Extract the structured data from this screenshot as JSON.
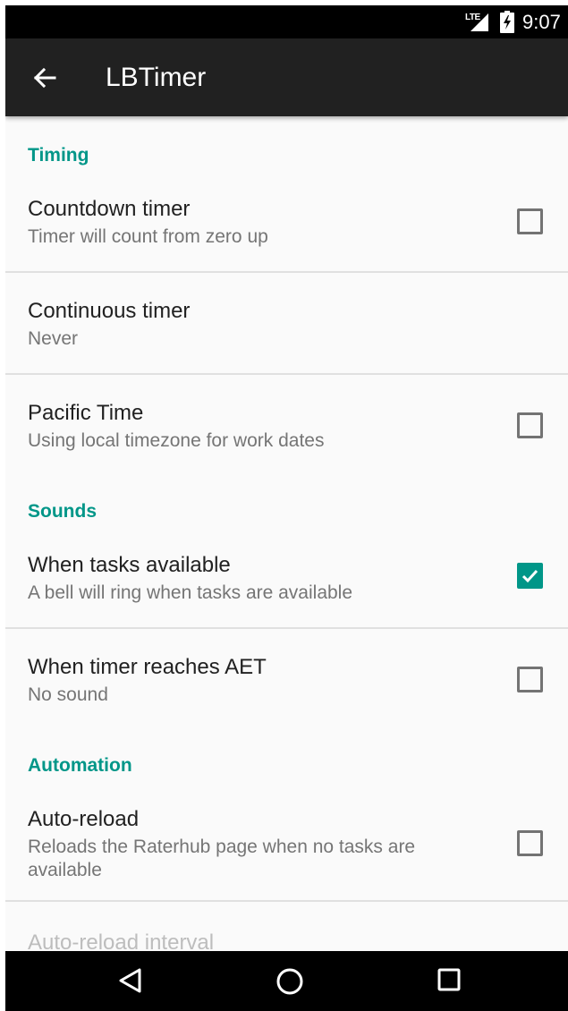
{
  "status_bar": {
    "network": "LTE",
    "time": "9:07"
  },
  "app_bar": {
    "title": "LBTimer",
    "back_icon": "arrow-left-icon"
  },
  "sections": [
    {
      "header": "Timing",
      "items": [
        {
          "title": "Countdown timer",
          "summary": "Timer will count from zero up",
          "checkbox": true,
          "checked": false
        },
        {
          "title": "Continuous timer",
          "summary": "Never",
          "checkbox": false
        },
        {
          "title": "Pacific Time",
          "summary": "Using local timezone for work dates",
          "checkbox": true,
          "checked": false
        }
      ]
    },
    {
      "header": "Sounds",
      "items": [
        {
          "title": "When tasks available",
          "summary": "A bell will ring when tasks are available",
          "checkbox": true,
          "checked": true
        },
        {
          "title": "When timer reaches AET",
          "summary": "No sound",
          "checkbox": true,
          "checked": false
        }
      ]
    },
    {
      "header": "Automation",
      "items": [
        {
          "title": "Auto-reload",
          "summary": "Reloads the Raterhub page when no tasks are available",
          "checkbox": true,
          "checked": false
        },
        {
          "title": "Auto-reload interval",
          "summary": "",
          "checkbox": false,
          "disabled": true
        }
      ]
    }
  ],
  "nav_bar": {
    "back": "triangle-back-icon",
    "home": "circle-home-icon",
    "recents": "square-recents-icon"
  },
  "colors": {
    "accent": "#009688",
    "app_bar": "#212121",
    "background": "#fafafa"
  }
}
